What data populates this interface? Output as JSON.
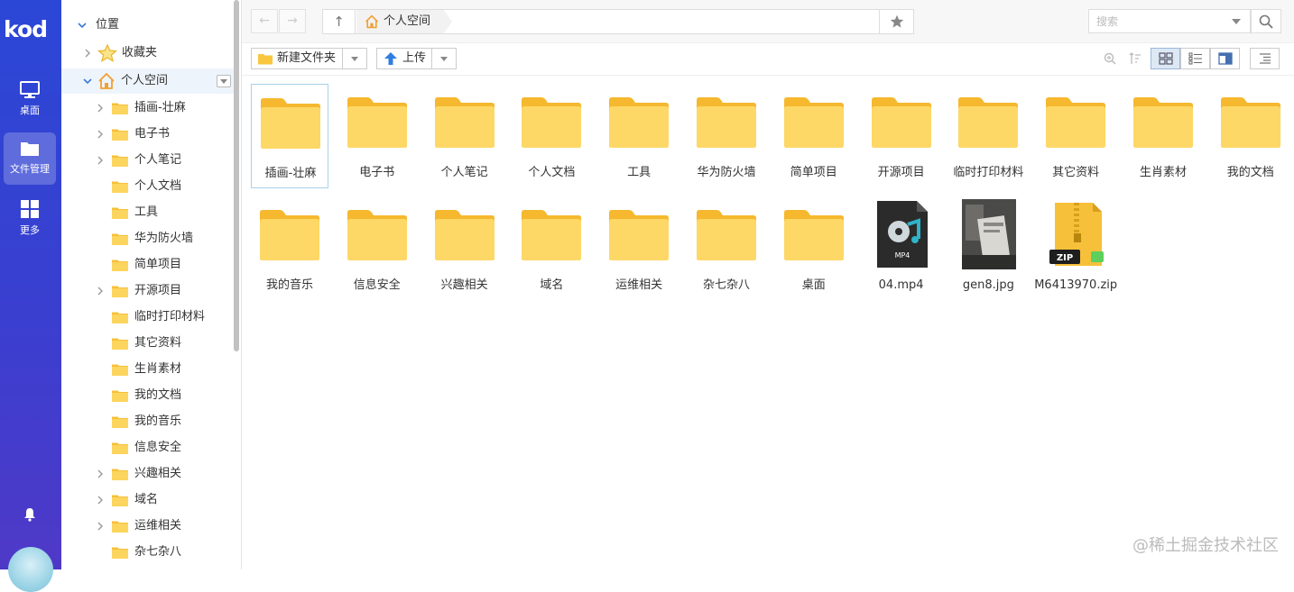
{
  "app": {
    "logo": "kod",
    "accent": "#3a43d2"
  },
  "rail": {
    "items": [
      {
        "label": "桌面",
        "icon": "desktop-icon"
      },
      {
        "label": "文件管理",
        "icon": "folder-manage-icon",
        "active": true
      },
      {
        "label": "更多",
        "icon": "grid-more-icon"
      }
    ]
  },
  "tree": {
    "location_label": "位置",
    "favorites_label": "收藏夹",
    "personal_label": "个人空间",
    "children": [
      {
        "label": "插画-壮麻",
        "expandable": true
      },
      {
        "label": "电子书",
        "expandable": true
      },
      {
        "label": "个人笔记",
        "expandable": true
      },
      {
        "label": "个人文档",
        "expandable": false
      },
      {
        "label": "工具",
        "expandable": false
      },
      {
        "label": "华为防火墙",
        "expandable": false
      },
      {
        "label": "简单项目",
        "expandable": false
      },
      {
        "label": "开源项目",
        "expandable": true
      },
      {
        "label": "临时打印材料",
        "expandable": false
      },
      {
        "label": "其它资料",
        "expandable": false
      },
      {
        "label": "生肖素材",
        "expandable": false
      },
      {
        "label": "我的文档",
        "expandable": false
      },
      {
        "label": "我的音乐",
        "expandable": false
      },
      {
        "label": "信息安全",
        "expandable": false
      },
      {
        "label": "兴趣相关",
        "expandable": true
      },
      {
        "label": "域名",
        "expandable": true
      },
      {
        "label": "运维相关",
        "expandable": true
      },
      {
        "label": "杂七杂八",
        "expandable": false
      }
    ]
  },
  "address": {
    "crumb": "个人空间"
  },
  "search": {
    "placeholder": "搜索"
  },
  "toolbar": {
    "new_folder_label": "新建文件夹",
    "upload_label": "上传"
  },
  "files": [
    {
      "name": "插画-壮麻",
      "type": "folder",
      "selected": true
    },
    {
      "name": "电子书",
      "type": "folder"
    },
    {
      "name": "个人笔记",
      "type": "folder"
    },
    {
      "name": "个人文档",
      "type": "folder"
    },
    {
      "name": "工具",
      "type": "folder"
    },
    {
      "name": "华为防火墙",
      "type": "folder"
    },
    {
      "name": "简单项目",
      "type": "folder"
    },
    {
      "name": "开源项目",
      "type": "folder"
    },
    {
      "name": "临时打印材料",
      "type": "folder"
    },
    {
      "name": "其它资料",
      "type": "folder"
    },
    {
      "name": "生肖素材",
      "type": "folder"
    },
    {
      "name": "我的文档",
      "type": "folder"
    },
    {
      "name": "我的音乐",
      "type": "folder"
    },
    {
      "name": "信息安全",
      "type": "folder"
    },
    {
      "name": "兴趣相关",
      "type": "folder"
    },
    {
      "name": "域名",
      "type": "folder"
    },
    {
      "name": "运维相关",
      "type": "folder"
    },
    {
      "name": "杂七杂八",
      "type": "folder"
    },
    {
      "name": "桌面",
      "type": "folder"
    },
    {
      "name": "04.mp4",
      "type": "video",
      "badge": "MP4"
    },
    {
      "name": "gen8.jpg",
      "type": "image"
    },
    {
      "name": "M6413970.zip",
      "type": "zip",
      "badge": "ZIP"
    }
  ],
  "watermark": "@稀土掘金技术社区"
}
